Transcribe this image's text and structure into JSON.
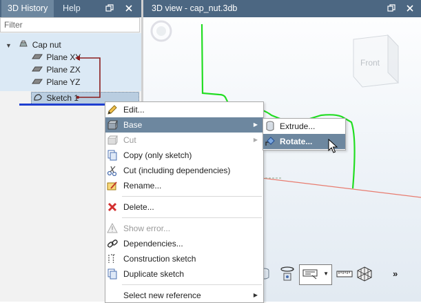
{
  "left_panel": {
    "tabs": [
      "3D History",
      "Help"
    ],
    "filter_placeholder": "Filter",
    "tree": {
      "root": "Cap nut",
      "items": [
        "Plane XY",
        "Plane ZX",
        "Plane YZ",
        "Sketch 1"
      ]
    }
  },
  "view": {
    "title": "3D view - cap_nut.3db",
    "cube_label": "Front"
  },
  "context_menu": {
    "items": [
      {
        "label": "Edit..."
      },
      {
        "label": "Base"
      },
      {
        "label": "Cut"
      },
      {
        "label": "Copy (only sketch)"
      },
      {
        "label": "Cut (including dependencies)"
      },
      {
        "label": "Rename..."
      },
      {
        "label": "Delete..."
      },
      {
        "label": "Show error..."
      },
      {
        "label": "Dependencies..."
      },
      {
        "label": "Construction sketch"
      },
      {
        "label": "Duplicate sketch"
      },
      {
        "label": "Select new reference"
      }
    ],
    "submenu": [
      {
        "label": "Extrude..."
      },
      {
        "label": "Rotate..."
      }
    ]
  },
  "toolbar": {
    "more_label": "»"
  },
  "colors": {
    "header": "#4c6782",
    "highlight": "#6d879f",
    "tree_bg": "#dbe9f5",
    "curve": "#22dd22"
  }
}
